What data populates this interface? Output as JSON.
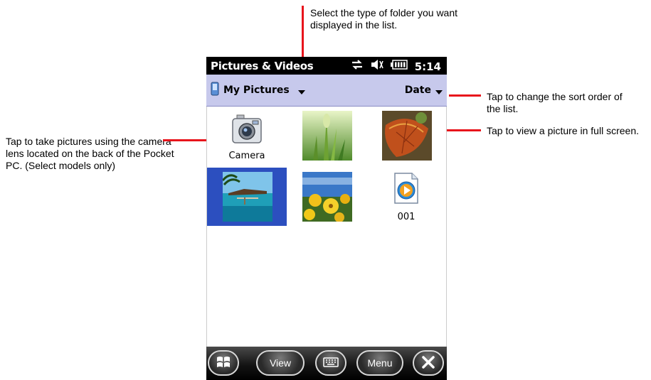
{
  "callouts": {
    "folder_type": "Select the type of folder you want displayed in the list.",
    "camera": "Tap to take pictures using the camera lens located on the back of the Pocket PC. (Select models only)",
    "sort_order": "Tap to change the sort order of the list.",
    "view_picture": "Tap to view a picture in full screen."
  },
  "statusbar": {
    "title": "Pictures & Videos",
    "time": "5:14"
  },
  "folderbar": {
    "folder": "My Pictures",
    "sort": "Date"
  },
  "tiles": [
    {
      "label": "Camera",
      "icon": "camera-icon"
    },
    {
      "label": "",
      "icon": "grass-thumbnail"
    },
    {
      "label": "",
      "icon": "leaf-thumbnail"
    },
    {
      "label": "",
      "icon": "beach-thumbnail",
      "selected": true
    },
    {
      "label": "",
      "icon": "flowers-thumbnail"
    },
    {
      "label": "001",
      "icon": "media-player-icon"
    }
  ],
  "taskbar": {
    "view": "View",
    "menu": "Menu"
  },
  "colors": {
    "accent_red": "#e8141c",
    "folderbar": "#c7c9ec",
    "selection": "#2c4fbf"
  }
}
